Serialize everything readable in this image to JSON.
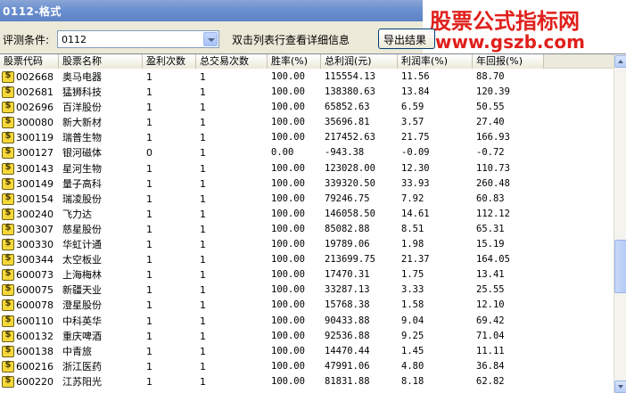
{
  "window": {
    "title": "0112-格式"
  },
  "watermark": {
    "line1": "股票公式指标网",
    "line2": "www.gszb.com"
  },
  "toolbar": {
    "condition_label": "评测条件:",
    "condition_value": "0112",
    "hint": "双击列表行查看详细信息",
    "export_label": "导出结果"
  },
  "columns": [
    "股票代码",
    "股票名称",
    "盈利次数",
    "总交易次数",
    "胜率(%)",
    "总利润(元)",
    "利润率(%)",
    "年回报(%)"
  ],
  "rows": [
    [
      "002668",
      "奥马电器",
      "1",
      "1",
      "100.00",
      "115554.13",
      "11.56",
      "88.70"
    ],
    [
      "002681",
      "猛狮科技",
      "1",
      "1",
      "100.00",
      "138380.63",
      "13.84",
      "120.39"
    ],
    [
      "002696",
      "百洋股份",
      "1",
      "1",
      "100.00",
      "65852.63",
      "6.59",
      "50.55"
    ],
    [
      "300080",
      "新大新材",
      "1",
      "1",
      "100.00",
      "35696.81",
      "3.57",
      "27.40"
    ],
    [
      "300119",
      "瑞普生物",
      "1",
      "1",
      "100.00",
      "217452.63",
      "21.75",
      "166.93"
    ],
    [
      "300127",
      "银河磁体",
      "0",
      "1",
      "0.00",
      "-943.38",
      "-0.09",
      "-0.72"
    ],
    [
      "300143",
      "星河生物",
      "1",
      "1",
      "100.00",
      "123028.00",
      "12.30",
      "110.73"
    ],
    [
      "300149",
      "量子高科",
      "1",
      "1",
      "100.00",
      "339320.50",
      "33.93",
      "260.48"
    ],
    [
      "300154",
      "瑞凌股份",
      "1",
      "1",
      "100.00",
      "79246.75",
      "7.92",
      "60.83"
    ],
    [
      "300240",
      "飞力达",
      "1",
      "1",
      "100.00",
      "146058.50",
      "14.61",
      "112.12"
    ],
    [
      "300307",
      "慈星股份",
      "1",
      "1",
      "100.00",
      "85082.88",
      "8.51",
      "65.31"
    ],
    [
      "300330",
      "华虹计通",
      "1",
      "1",
      "100.00",
      "19789.06",
      "1.98",
      "15.19"
    ],
    [
      "300344",
      "太空板业",
      "1",
      "1",
      "100.00",
      "213699.75",
      "21.37",
      "164.05"
    ],
    [
      "600073",
      "上海梅林",
      "1",
      "1",
      "100.00",
      "17470.31",
      "1.75",
      "13.41"
    ],
    [
      "600075",
      "新疆天业",
      "1",
      "1",
      "100.00",
      "33287.13",
      "3.33",
      "25.55"
    ],
    [
      "600078",
      "澄星股份",
      "1",
      "1",
      "100.00",
      "15768.38",
      "1.58",
      "12.10"
    ],
    [
      "600110",
      "中科英华",
      "1",
      "1",
      "100.00",
      "90433.88",
      "9.04",
      "69.42"
    ],
    [
      "600132",
      "重庆啤酒",
      "1",
      "1",
      "100.00",
      "92536.88",
      "9.25",
      "71.04"
    ],
    [
      "600138",
      "中青旅",
      "1",
      "1",
      "100.00",
      "14470.44",
      "1.45",
      "11.11"
    ],
    [
      "600216",
      "浙江医药",
      "1",
      "1",
      "100.00",
      "47991.06",
      "4.80",
      "36.84"
    ],
    [
      "600220",
      "江苏阳光",
      "1",
      "1",
      "100.00",
      "81831.88",
      "8.18",
      "62.82"
    ]
  ]
}
